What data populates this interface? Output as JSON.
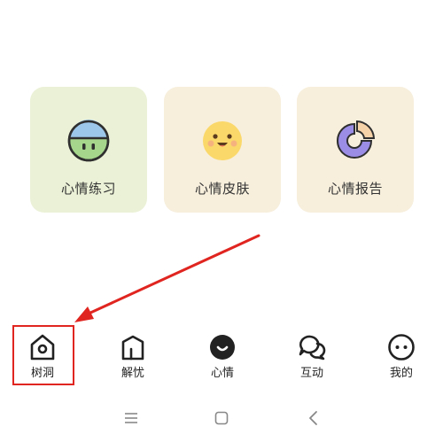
{
  "cards": [
    {
      "label": "心情练习",
      "icon": "mood-practice-face-icon",
      "color": "#eaf1d6"
    },
    {
      "label": "心情皮肤",
      "icon": "smiley-face-icon",
      "color": "#f7eedc"
    },
    {
      "label": "心情报告",
      "icon": "pie-chart-icon",
      "color": "#f7eedc"
    }
  ],
  "tabbar": {
    "items": [
      {
        "label": "树洞",
        "icon": "tree-hole-icon"
      },
      {
        "label": "解忧",
        "icon": "door-icon"
      },
      {
        "label": "心情",
        "icon": "mood-smile-icon"
      },
      {
        "label": "互动",
        "icon": "chat-bubbles-icon"
      },
      {
        "label": "我的",
        "icon": "profile-face-icon"
      }
    ]
  },
  "annotation": {
    "color": "#e0241f"
  },
  "navbar": {
    "icons": [
      "menu-icon",
      "home-icon",
      "back-icon"
    ]
  }
}
